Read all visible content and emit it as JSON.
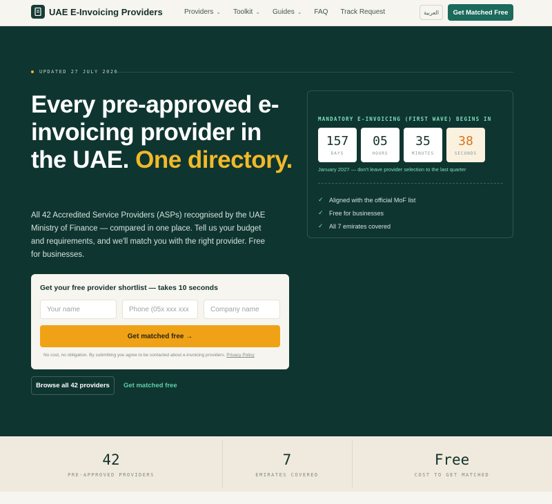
{
  "nav": {
    "brand_name": "UAE E-Invoicing Providers",
    "brand_icon": "document-icon",
    "links": [
      {
        "label": "Providers",
        "has_menu": true
      },
      {
        "label": "Toolkit",
        "has_menu": true
      },
      {
        "label": "Guides",
        "has_menu": true
      },
      {
        "label": "FAQ",
        "has_menu": false
      },
      {
        "label": "Track Request",
        "has_menu": false
      }
    ],
    "language_label": "العربية",
    "cta_label": "Get Matched Free"
  },
  "hero": {
    "updated_label": "UPDATED 27 JULY 2026",
    "headline_main": "Every pre-approved e-invoicing provider in the UAE.",
    "headline_accent": "One directory.",
    "lede": "All 42 Accredited Service Providers (ASPs) recognised by the UAE Ministry of Finance — compared in one place. Tell us your budget and requirements, and we'll match you with the right provider. Free for businesses."
  },
  "form": {
    "title": "Get your free provider shortlist — takes 10 seconds",
    "name_placeholder": "Your name",
    "phone_placeholder": "Phone (05x xxx xxx",
    "company_placeholder": "Company name",
    "submit_label": "Get matched free →",
    "fine_print": "No cost, no obligation. By submitting you agree to be contacted about e-invoicing providers.",
    "privacy_label": "Privacy Policy"
  },
  "secondary": {
    "browse_label": "Browse all 42 providers",
    "get_free_label": "Get matched free"
  },
  "countdown": {
    "title": "MANDATORY E-INVOICING (FIRST WAVE) BEGINS IN",
    "tiles": [
      {
        "value": "157",
        "unit": "DAYS"
      },
      {
        "value": "05",
        "unit": "HOURS"
      },
      {
        "value": "35",
        "unit": "MINUTES"
      },
      {
        "value": "38",
        "unit": "SECONDS"
      }
    ],
    "note": "January 2027 — don't leave provider selection to the last quarter",
    "checks": [
      "Aligned with the official MoF list",
      "Free for businesses",
      "All 7 emirates covered"
    ]
  },
  "stats": [
    {
      "value": "42",
      "label": "PRE-APPROVED PROVIDERS"
    },
    {
      "value": "7",
      "label": "EMIRATES COVERED"
    },
    {
      "value": "Free",
      "label": "COST TO GET MATCHED"
    }
  ],
  "colors": {
    "hero_bg": "#0f3530",
    "accent_yellow": "#f2b928",
    "cta_orange": "#f0a216",
    "brand_green": "#1b6a5b",
    "mint": "#7fe0bd"
  }
}
